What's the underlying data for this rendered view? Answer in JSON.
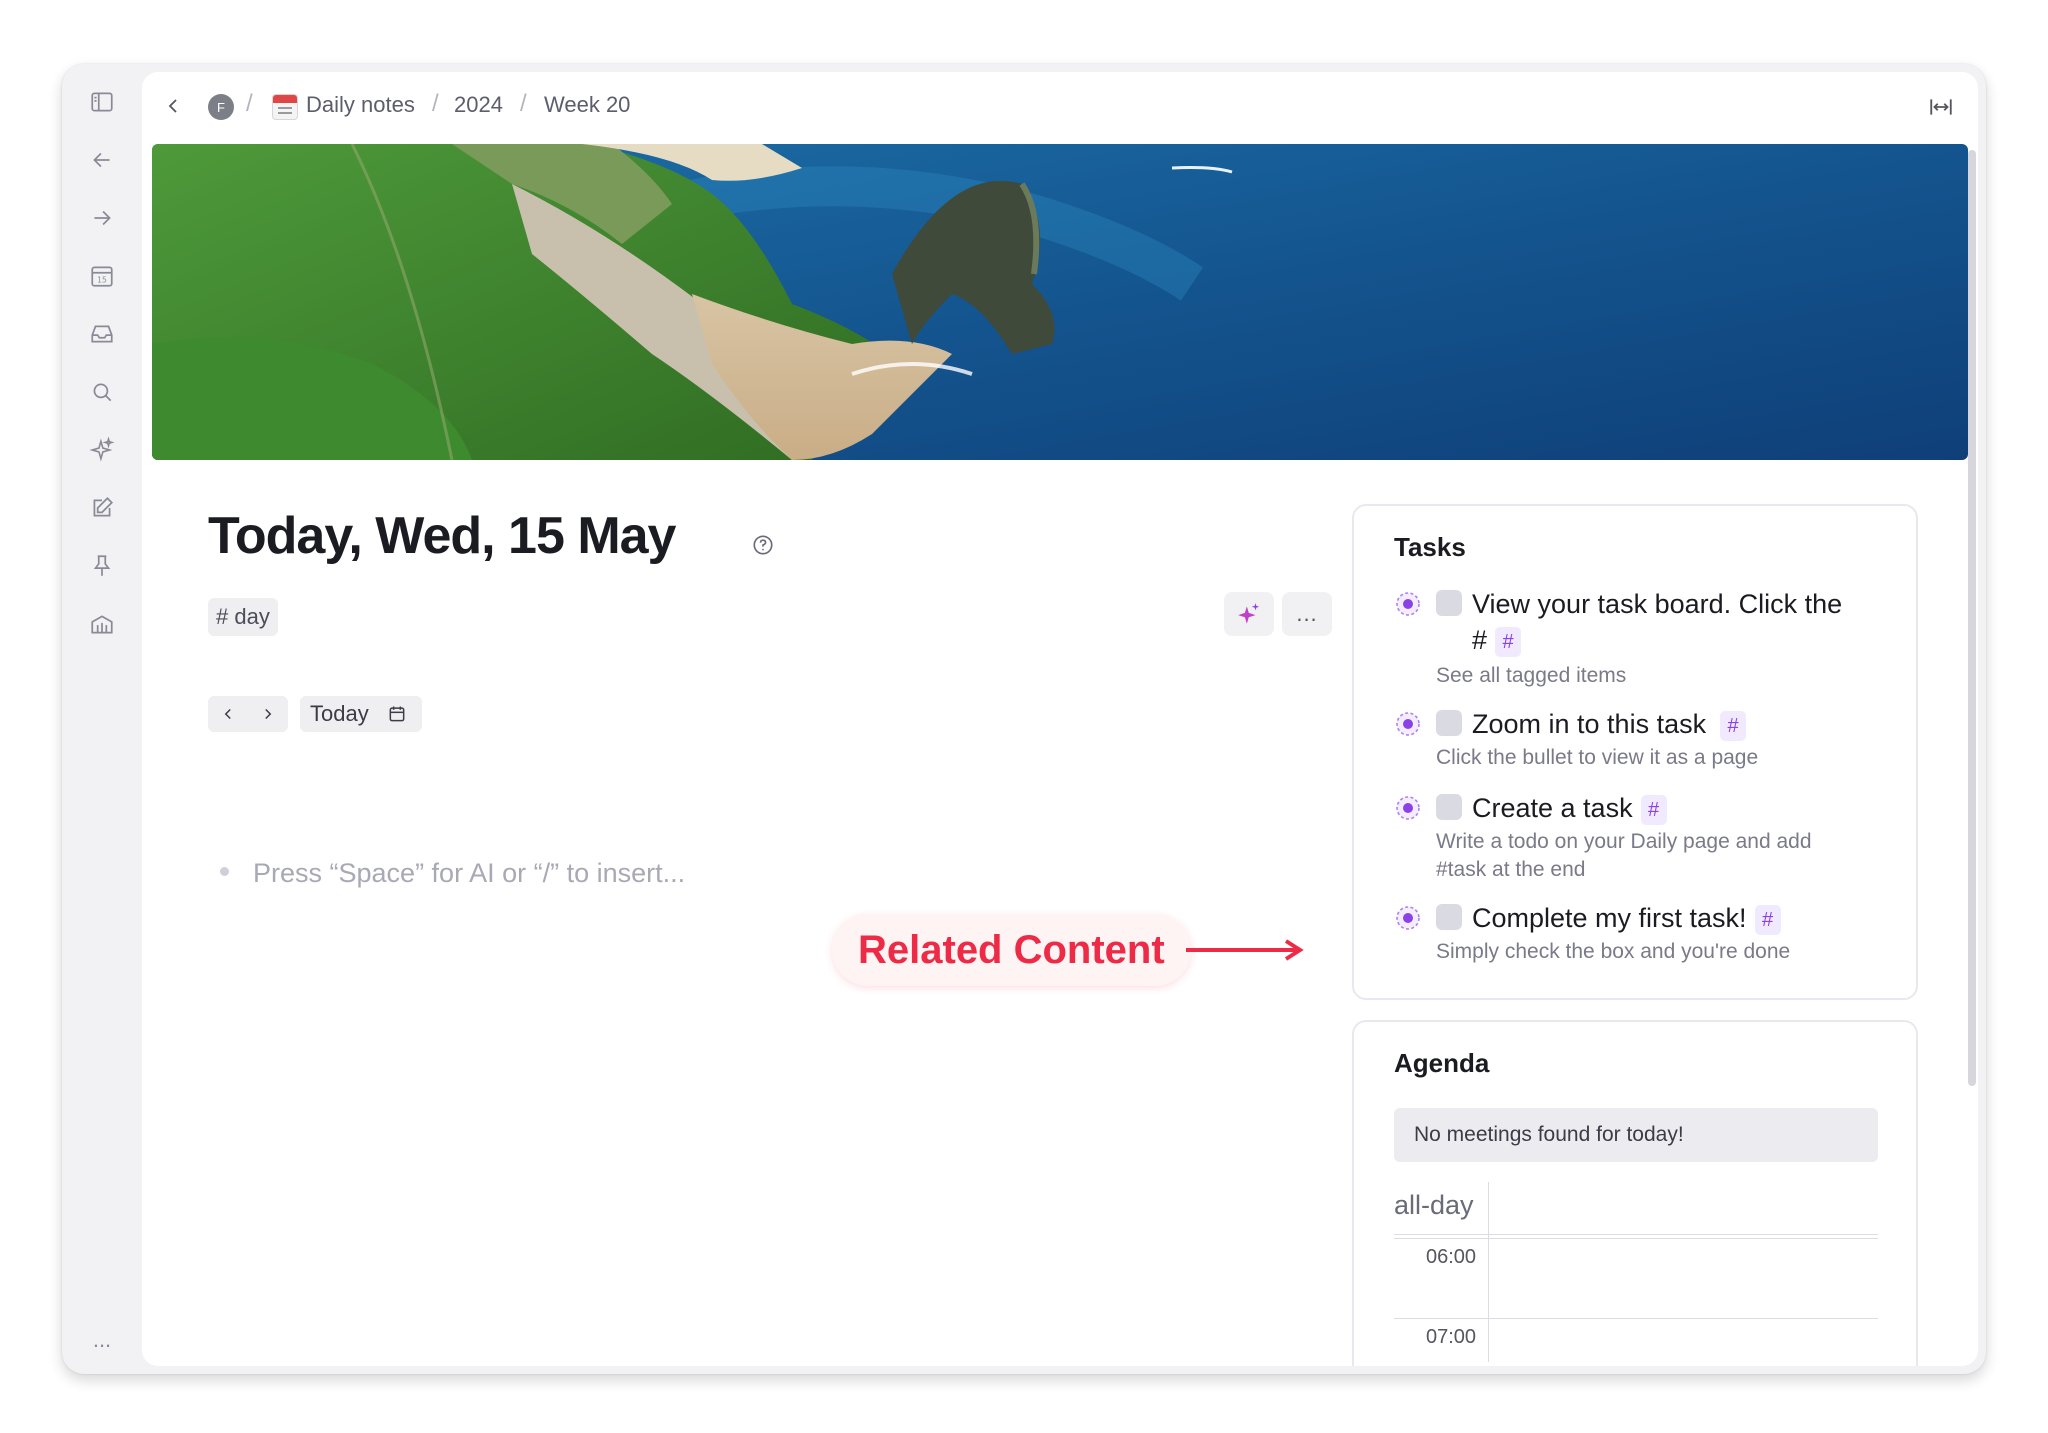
{
  "breadcrumb": {
    "avatar_letter": "F",
    "items": [
      "Daily notes",
      "2024",
      "Week 20"
    ]
  },
  "page": {
    "title": "Today, Wed, 15 May",
    "tag": "# day",
    "more_label": "...",
    "today_label": "Today",
    "placeholder": "Press “Space” for AI or “/” to insert..."
  },
  "annotation": {
    "label": "Related Content",
    "color": "#ee2b47"
  },
  "tasks_card": {
    "title": "Tasks",
    "items": [
      {
        "text": "View your task board. Click the",
        "text_line2": "#",
        "subtitle": "See all tagged items",
        "tag": "#"
      },
      {
        "text": "Zoom in to this task",
        "subtitle": "Click the bullet to view it as a page",
        "tag": "#"
      },
      {
        "text": "Create a task",
        "subtitle": "Write a todo on your Daily page and add",
        "subtitle_line2": "#task at the end",
        "tag": "#"
      },
      {
        "text": "Complete my first task!",
        "subtitle": "Simply check the box and you're done",
        "tag": "#"
      }
    ]
  },
  "agenda_card": {
    "title": "Agenda",
    "empty_message": "No meetings found for today!",
    "allday_label": "all-day",
    "hours": [
      "06:00",
      "07:00"
    ]
  },
  "rail": {
    "icons": [
      "sidebar-toggle-icon",
      "back-arrow-icon",
      "forward-arrow-icon",
      "calendar-icon",
      "inbox-icon",
      "search-icon",
      "sparkle-icon",
      "compose-icon",
      "pin-icon",
      "library-icon"
    ],
    "more_label": "..."
  },
  "colors": {
    "accent_purple": "#8a42e6",
    "tag_bg": "#f1eaff",
    "annotation_red": "#ee2b47"
  }
}
